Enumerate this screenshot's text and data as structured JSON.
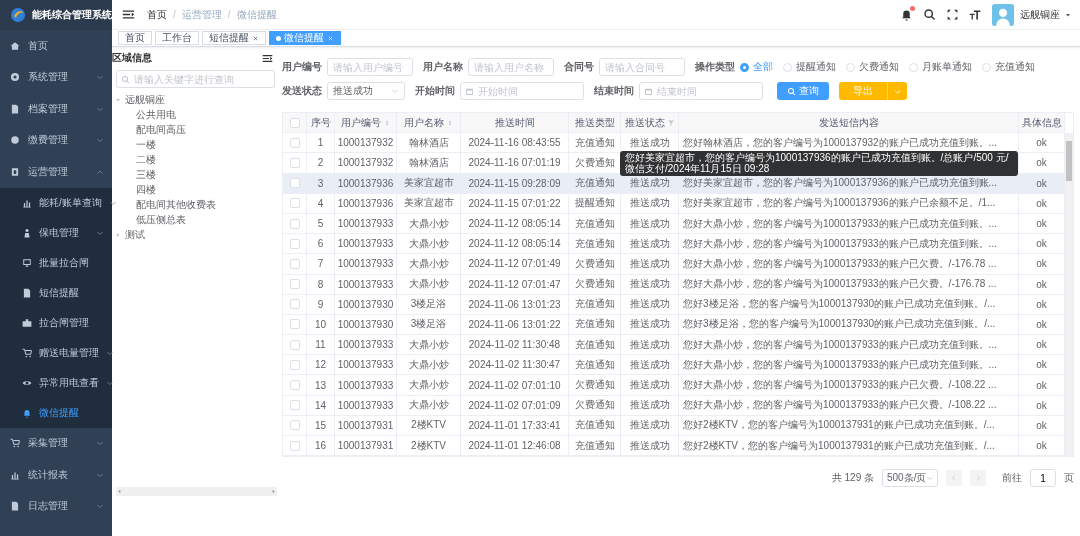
{
  "app": {
    "title": "能耗综合管理系统"
  },
  "sidebar": {
    "items": [
      {
        "label": "首页",
        "selected": false
      },
      {
        "label": "系统管理",
        "selected": false,
        "expanded": false
      },
      {
        "label": "档案管理",
        "selected": false,
        "expanded": false
      },
      {
        "label": "缴费管理",
        "selected": false,
        "expanded": false
      },
      {
        "label": "运营管理",
        "selected": false,
        "expanded": true,
        "children": [
          {
            "label": "能耗/账单查询",
            "selected": false,
            "expanded": false
          },
          {
            "label": "保电管理",
            "selected": false,
            "expanded": false
          },
          {
            "label": "批量拉合闸",
            "selected": false
          },
          {
            "label": "短信提醒",
            "selected": false
          },
          {
            "label": "拉合闸管理",
            "selected": false
          },
          {
            "label": "赠送电量管理",
            "selected": false,
            "expanded": false
          },
          {
            "label": "异常用电查看",
            "selected": false,
            "expanded": false
          },
          {
            "label": "微信提醒",
            "selected": true
          }
        ]
      },
      {
        "label": "采集管理",
        "selected": false,
        "expanded": false
      },
      {
        "label": "统计报表",
        "selected": false,
        "expanded": false
      },
      {
        "label": "日志管理",
        "selected": false,
        "expanded": false
      }
    ]
  },
  "breadcrumb": {
    "separator": "/",
    "items": [
      "首页",
      "运营管理",
      "微信提醒"
    ]
  },
  "user": {
    "name": "远舰铜座",
    "unread": true
  },
  "tags": [
    {
      "label": "首页",
      "selected": false,
      "closable": false
    },
    {
      "label": "工作台",
      "selected": false,
      "closable": false
    },
    {
      "label": "短信提醒",
      "selected": false,
      "closable": true
    },
    {
      "label": "微信提醒",
      "selected": true,
      "closable": true
    }
  ],
  "tree": {
    "title": "区域信息",
    "search": {
      "placeholder": "请输入关键字进行查询"
    },
    "nodes": [
      {
        "label": "远舰铜座",
        "expanded": true,
        "children": [
          {
            "label": "公共用电"
          },
          {
            "label": "配电间高压"
          },
          {
            "label": "一楼"
          },
          {
            "label": "二楼"
          },
          {
            "label": "三楼"
          },
          {
            "label": "四楼"
          },
          {
            "label": "配电间其他收费表"
          },
          {
            "label": "低压侧总表"
          }
        ]
      },
      {
        "label": "测试",
        "expanded": false
      }
    ]
  },
  "filter_rows": [
    {
      "fields": [
        {
          "kind": "text",
          "label": "用户编号",
          "placeholder": "请输入用户编号"
        },
        {
          "kind": "text",
          "label": "用户名称",
          "placeholder": "请输入用户名称"
        },
        {
          "kind": "text",
          "label": "合同号",
          "placeholder": "请输入合同号"
        },
        {
          "kind": "radio",
          "label": "操作类型",
          "options": [
            {
              "label": "全部",
              "selected": true
            },
            {
              "label": "提醒通知",
              "selected": false
            },
            {
              "label": "欠费通知",
              "selected": false
            },
            {
              "label": "月账单通知",
              "selected": false
            },
            {
              "label": "充值通知",
              "selected": false
            }
          ]
        }
      ]
    },
    {
      "fields": [
        {
          "kind": "select",
          "label": "发送状态",
          "value": "推送成功"
        },
        {
          "kind": "date",
          "label": "开始时间",
          "placeholder": "开始时间"
        },
        {
          "kind": "date",
          "label": "结束时间",
          "placeholder": "结束时间"
        }
      ],
      "buttons": [
        {
          "kind": "search",
          "label": "查询"
        },
        {
          "kind": "split",
          "label": "导出"
        }
      ]
    }
  ],
  "table": {
    "columns": [
      {
        "kind": "checkbox",
        "checked": false
      },
      {
        "label": "序号"
      },
      {
        "label": "用户编号",
        "sortable": true
      },
      {
        "label": "用户名称",
        "sortable": true
      },
      {
        "label": "推送时间"
      },
      {
        "label": "推送类型"
      },
      {
        "label": "推送状态",
        "filterable": true
      },
      {
        "label": "发送短信内容"
      },
      {
        "label": "具体信息"
      }
    ],
    "rows": [
      {
        "checked": false,
        "hovered": false,
        "index": "1",
        "user_id": "1000137932",
        "user_name": "翰林酒店",
        "time": "2024-11-16 08:43:55",
        "type": "充值通知",
        "status": "推送成功",
        "content": "您好翰林酒店，您的客户编号为1000137932的账户已成功充值到账。...",
        "info": "ok"
      },
      {
        "checked": false,
        "hovered": false,
        "index": "2",
        "user_id": "1000137932",
        "user_name": "翰林酒店",
        "time": "2024-11-16 07:01:19",
        "type": "欠费通知",
        "info": "ok"
      },
      {
        "checked": false,
        "hovered": true,
        "index": "3",
        "user_id": "1000137936",
        "user_name": "美家宜超市",
        "time": "2024-11-15 09:28:09",
        "type": "充值通知",
        "status": "推送成功",
        "content": "您好美家宜超市，您的客户编号为1000137936的账户已成功充值到账...",
        "info": "ok"
      },
      {
        "checked": false,
        "hovered": false,
        "index": "4",
        "user_id": "1000137936",
        "user_name": "美家宜超市",
        "time": "2024-11-15 07:01:22",
        "type": "提醒通知",
        "status": "推送成功",
        "content": "您好美家宜超市，您的客户编号为1000137936的账户已余额不足。/1...",
        "info": "ok"
      },
      {
        "checked": false,
        "hovered": false,
        "index": "5",
        "user_id": "1000137933",
        "user_name": "大鼎小炒",
        "time": "2024-11-12 08:05:14",
        "type": "充值通知",
        "status": "推送成功",
        "content": "您好大鼎小炒，您的客户编号为1000137933的账户已成功充值到账。...",
        "info": "ok"
      },
      {
        "checked": false,
        "hovered": false,
        "index": "6",
        "user_id": "1000137933",
        "user_name": "大鼎小炒",
        "time": "2024-11-12 08:05:14",
        "type": "充值通知",
        "status": "推送成功",
        "content": "您好大鼎小炒，您的客户编号为1000137933的账户已成功充值到账。...",
        "info": "ok"
      },
      {
        "checked": false,
        "hovered": false,
        "index": "7",
        "user_id": "1000137933",
        "user_name": "大鼎小炒",
        "time": "2024-11-12 07:01:49",
        "type": "欠费通知",
        "status": "推送成功",
        "content": "您好大鼎小炒，您的客户编号为1000137933的账户已欠费。/-176.78 ...",
        "info": "ok"
      },
      {
        "checked": false,
        "hovered": false,
        "index": "8",
        "user_id": "1000137933",
        "user_name": "大鼎小炒",
        "time": "2024-11-12 07:01:47",
        "type": "欠费通知",
        "status": "推送成功",
        "content": "您好大鼎小炒，您的客户编号为1000137933的账户已欠费。/-176.78 ...",
        "info": "ok"
      },
      {
        "checked": false,
        "hovered": false,
        "index": "9",
        "user_id": "1000137930",
        "user_name": "3楼足浴",
        "time": "2024-11-06 13:01:23",
        "type": "充值通知",
        "status": "推送成功",
        "content": "您好3楼足浴，您的客户编号为1000137930的账户已成功充值到账。/...",
        "info": "ok"
      },
      {
        "checked": false,
        "hovered": false,
        "index": "10",
        "user_id": "1000137930",
        "user_name": "3楼足浴",
        "time": "2024-11-06 13:01:22",
        "type": "充值通知",
        "status": "推送成功",
        "content": "您好3楼足浴，您的客户编号为1000137930的账户已成功充值到账。/...",
        "info": "ok"
      },
      {
        "checked": false,
        "hovered": false,
        "index": "11",
        "user_id": "1000137933",
        "user_name": "大鼎小炒",
        "time": "2024-11-02 11:30:48",
        "type": "充值通知",
        "status": "推送成功",
        "content": "您好大鼎小炒，您的客户编号为1000137933的账户已成功充值到账。...",
        "info": "ok"
      },
      {
        "checked": false,
        "hovered": false,
        "index": "12",
        "user_id": "1000137933",
        "user_name": "大鼎小炒",
        "time": "2024-11-02 11:30:47",
        "type": "充值通知",
        "status": "推送成功",
        "content": "您好大鼎小炒，您的客户编号为1000137933的账户已成功充值到账。...",
        "info": "ok"
      },
      {
        "checked": false,
        "hovered": false,
        "index": "13",
        "user_id": "1000137933",
        "user_name": "大鼎小炒",
        "time": "2024-11-02 07:01:10",
        "type": "欠费通知",
        "status": "推送成功",
        "content": "您好大鼎小炒，您的客户编号为1000137933的账户已欠费。/-108.22 ...",
        "info": "ok"
      },
      {
        "checked": false,
        "hovered": false,
        "index": "14",
        "user_id": "1000137933",
        "user_name": "大鼎小炒",
        "time": "2024-11-02 07:01:09",
        "type": "欠费通知",
        "status": "推送成功",
        "content": "您好大鼎小炒，您的客户编号为1000137933的账户已欠费。/-108.22 ...",
        "info": "ok"
      },
      {
        "checked": false,
        "hovered": false,
        "index": "15",
        "user_id": "1000137931",
        "user_name": "2楼KTV",
        "time": "2024-11-01 17:33:41",
        "type": "充值通知",
        "status": "推送成功",
        "content": "您好2楼KTV，您的客户编号为1000137931的账户已成功充值到账。/...",
        "info": "ok"
      },
      {
        "checked": false,
        "hovered": false,
        "index": "16",
        "user_id": "1000137931",
        "user_name": "2楼KTV",
        "time": "2024-11-01 12:46:08",
        "type": "充值通知",
        "status": "推送成功",
        "content": "您好2楼KTV，您的客户编号为1000137931的账户已成功充值到账。/...",
        "info": "ok"
      }
    ],
    "tooltip": {
      "text": "您好美家宜超市，您的客户编号为1000137936的账户已成功充值到账。/总账户/500 元/微信支付/2024年11月15日 09:28"
    }
  },
  "pagination": {
    "total": "共 129 条",
    "page_size": "500条/页",
    "goto_label": "前往",
    "page": "1",
    "page_unit": "页",
    "prev_disabled": true,
    "next_disabled": true
  }
}
